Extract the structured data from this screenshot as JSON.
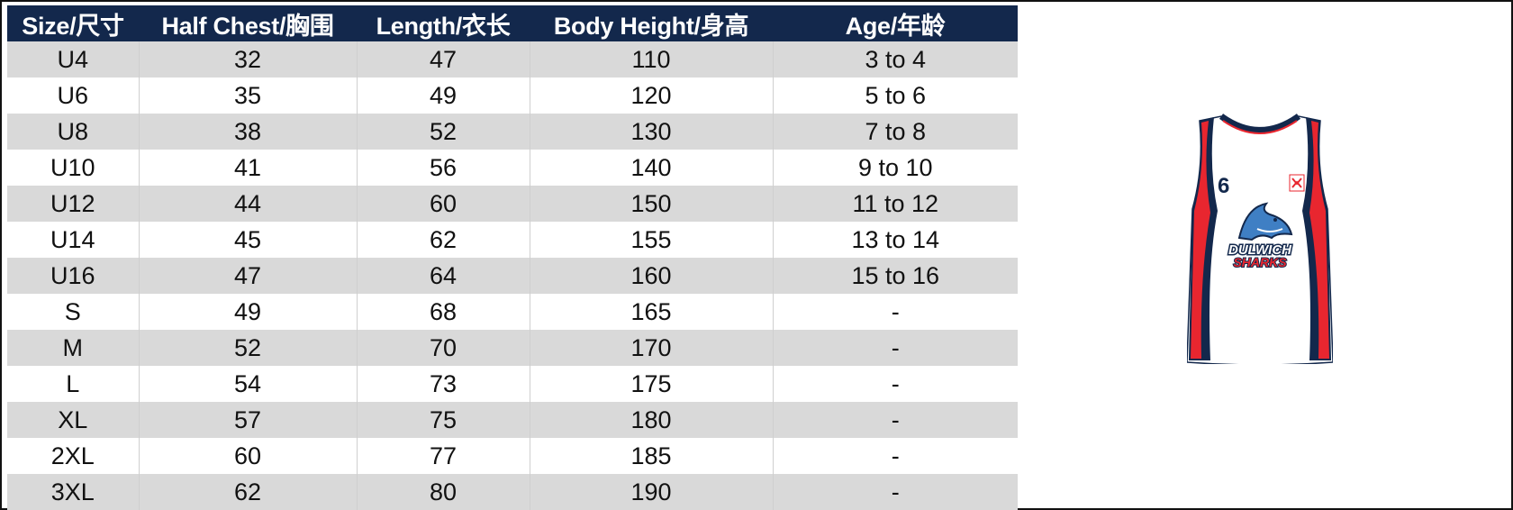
{
  "headers": [
    "Size/尺寸",
    "Half Chest/胸围",
    "Length/衣长",
    "Body Height/身高",
    "Age/年龄"
  ],
  "rows": [
    [
      "U4",
      "32",
      "47",
      "110",
      "3 to 4"
    ],
    [
      "U6",
      "35",
      "49",
      "120",
      "5 to 6"
    ],
    [
      "U8",
      "38",
      "52",
      "130",
      "7 to 8"
    ],
    [
      "U10",
      "41",
      "56",
      "140",
      "9 to 10"
    ],
    [
      "U12",
      "44",
      "60",
      "150",
      "11 to 12"
    ],
    [
      "U14",
      "45",
      "62",
      "155",
      "13 to 14"
    ],
    [
      "U16",
      "47",
      "64",
      "160",
      "15 to 16"
    ],
    [
      "S",
      "49",
      "68",
      "165",
      "-"
    ],
    [
      "M",
      "52",
      "70",
      "170",
      "-"
    ],
    [
      "L",
      "54",
      "73",
      "175",
      "-"
    ],
    [
      "XL",
      "57",
      "75",
      "180",
      "-"
    ],
    [
      "2XL",
      "60",
      "77",
      "185",
      "-"
    ],
    [
      "3XL",
      "62",
      "80",
      "190",
      "-"
    ]
  ],
  "jersey": {
    "number": "6",
    "logo_line1": "DULWICH",
    "logo_line2": "SHARKS",
    "colors": {
      "navy": "#13284c",
      "red": "#e8262f",
      "white": "#ffffff"
    },
    "icons": [
      "jersey-image",
      "shark-logo-icon",
      "crest-icon"
    ]
  }
}
